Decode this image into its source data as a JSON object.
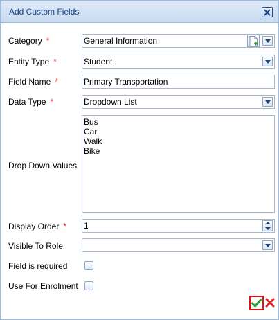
{
  "dialog": {
    "title": "Add Custom Fields"
  },
  "form": {
    "category": {
      "label": "Category",
      "required_mark": "*",
      "value": "General Information"
    },
    "entity_type": {
      "label": "Entity Type",
      "required_mark": "*",
      "value": "Student"
    },
    "field_name": {
      "label": "Field Name",
      "required_mark": "*",
      "value": "Primary Transportation"
    },
    "data_type": {
      "label": "Data Type",
      "required_mark": "*",
      "value": "Dropdown List"
    },
    "dropdown_values": {
      "label": "Drop Down Values",
      "values": [
        "Bus",
        "Car",
        "Walk",
        "Bike"
      ]
    },
    "display_order": {
      "label": "Display Order",
      "required_mark": "*",
      "value": "1"
    },
    "visible_to_role": {
      "label": "Visible To Role",
      "value": ""
    },
    "field_required": {
      "label": "Field is required",
      "checked": false
    },
    "use_for_enrolment": {
      "label": "Use For Enrolment",
      "checked": false
    }
  },
  "colors": {
    "title_text": "#15428b",
    "required": "#e02020",
    "save_highlight": "#e01010",
    "save_check": "#2e9d2e",
    "cancel_x": "#d42020"
  },
  "icons": {
    "close": "close-icon",
    "dropdown": "chevron-down-icon",
    "add": "add-document-icon",
    "spinner": "spinner-arrows-icon",
    "save": "checkmark-icon",
    "cancel": "x-icon"
  }
}
